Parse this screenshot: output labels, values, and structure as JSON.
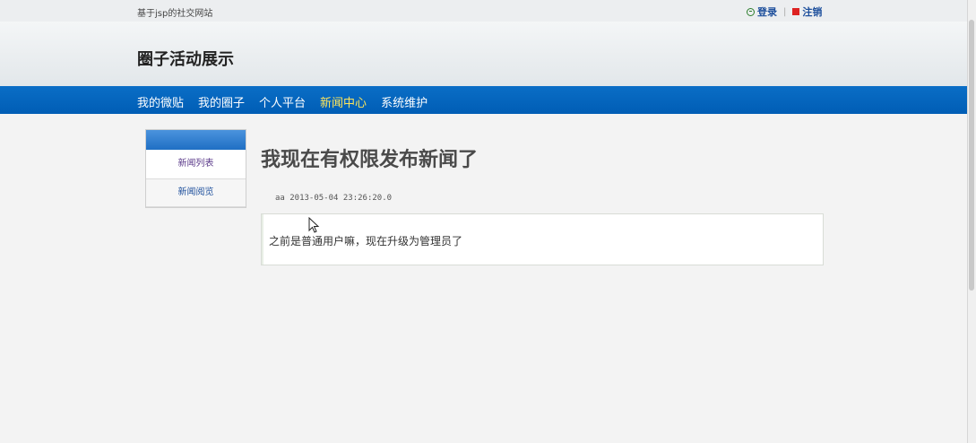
{
  "topbar": {
    "site_name": "基于jsp的社交网站",
    "login_label": "登录",
    "logout_label": "注销"
  },
  "header": {
    "title": "圈子活动展示"
  },
  "nav": {
    "items": [
      {
        "label": "我的微贴"
      },
      {
        "label": "我的圈子"
      },
      {
        "label": "个人平台"
      },
      {
        "label": "新闻中心",
        "active": true
      },
      {
        "label": "系统维护"
      }
    ]
  },
  "sidebar": {
    "items": [
      {
        "label": "新闻列表"
      },
      {
        "label": "新闻阅览"
      }
    ]
  },
  "article": {
    "title": "我现在有权限发布新闻了",
    "meta": "aa 2013-05-04 23:26:20.0",
    "body": "之前是普通用户嘛，现在升级为管理员了"
  },
  "colors": {
    "nav_bg": "#0a6ec6",
    "nav_active": "#ffe55a",
    "link": "#1d4f9c"
  }
}
